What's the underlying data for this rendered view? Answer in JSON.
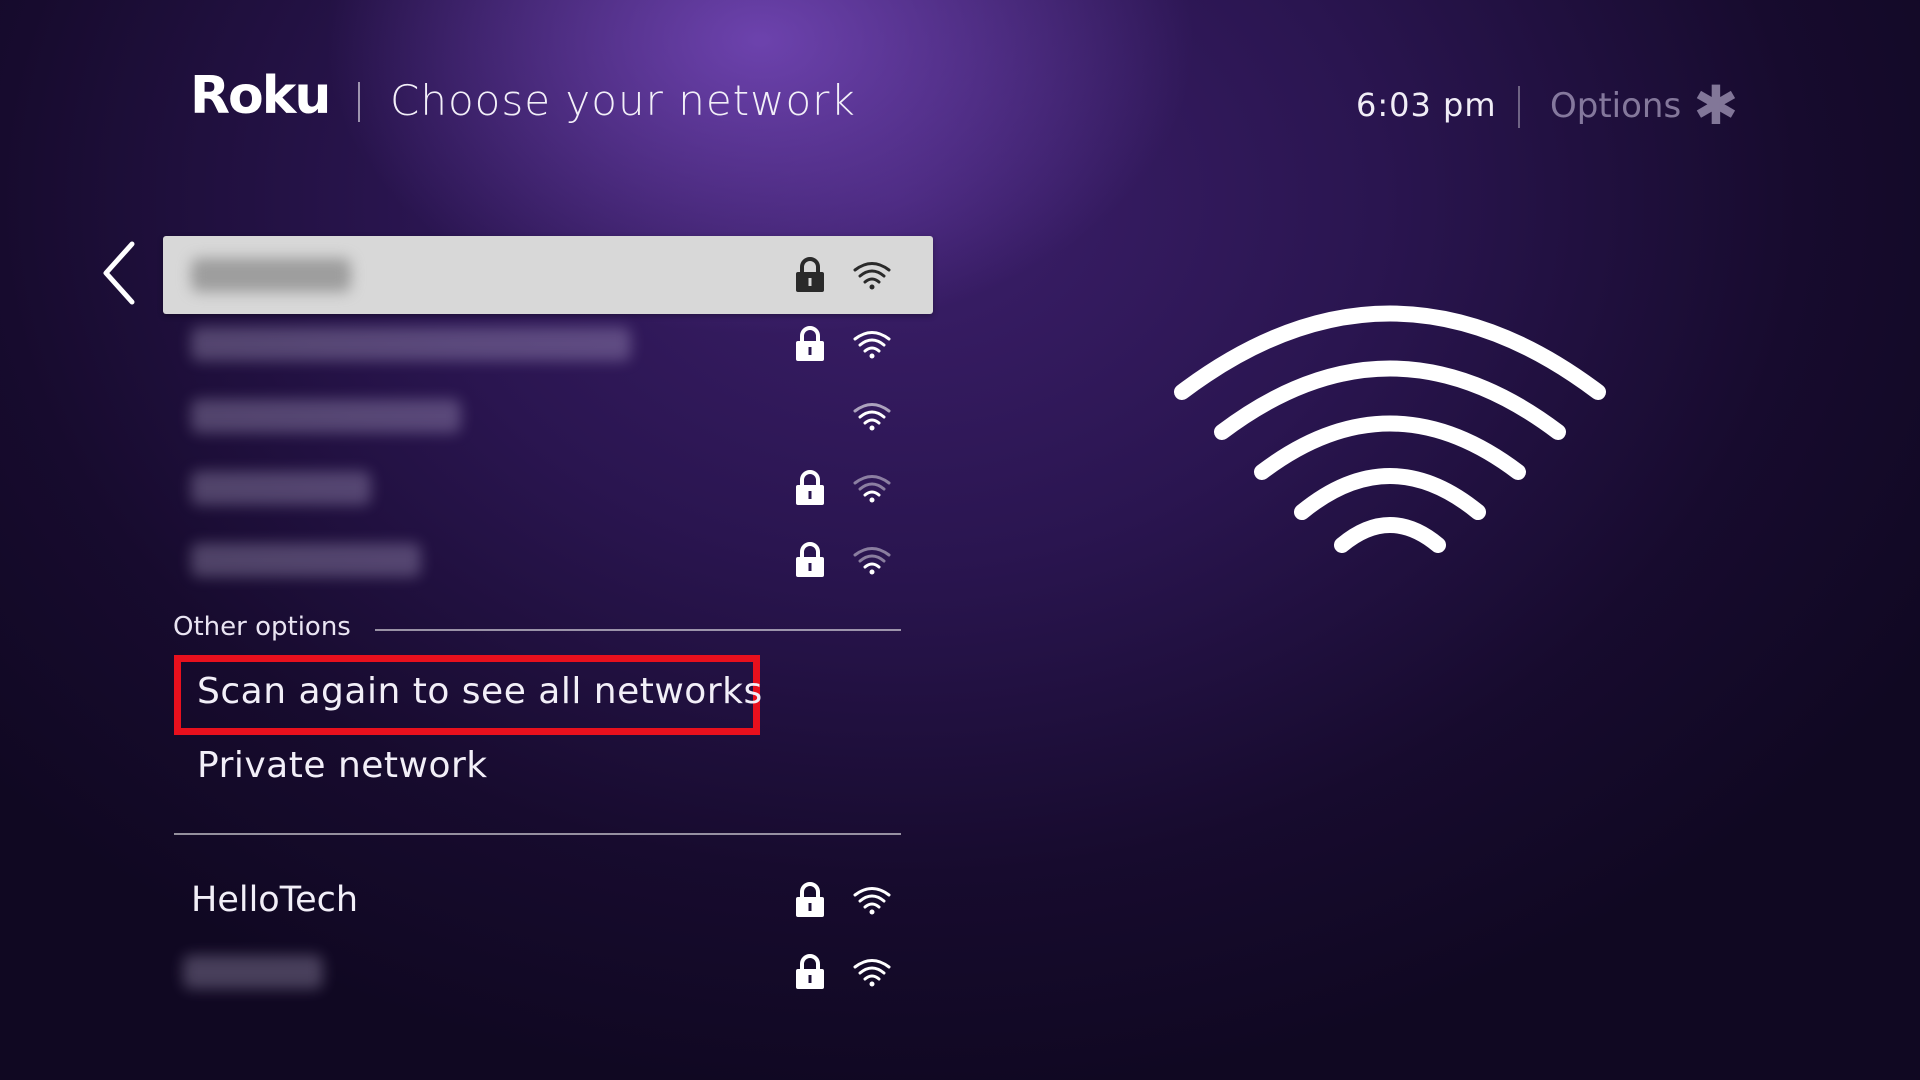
{
  "header": {
    "logo": "Roku",
    "title": "Choose your network",
    "time": "6:03 pm",
    "options_label": "Options",
    "options_icon": "asterisk-icon"
  },
  "networks": [
    {
      "name": "",
      "blurred": true,
      "secured": true,
      "selected": true,
      "signal": "strong"
    },
    {
      "name": "",
      "blurred": true,
      "secured": true,
      "selected": false,
      "signal": "strong"
    },
    {
      "name": "",
      "blurred": true,
      "secured": false,
      "selected": false,
      "signal": "medium"
    },
    {
      "name": "",
      "blurred": true,
      "secured": true,
      "selected": false,
      "signal": "weak"
    },
    {
      "name": "",
      "blurred": true,
      "secured": true,
      "selected": false,
      "signal": "weak"
    }
  ],
  "other_options": {
    "label": "Other options",
    "scan_label": "Scan again to see all networks",
    "private_label": "Private network"
  },
  "more_networks": [
    {
      "name": "HelloTech",
      "blurred": false,
      "secured": true,
      "signal": "strong"
    },
    {
      "name": "",
      "blurred": true,
      "secured": true,
      "signal": "strong"
    }
  ],
  "colors": {
    "highlight_border": "#e8101d",
    "selected_row": "#d8d8d8"
  }
}
